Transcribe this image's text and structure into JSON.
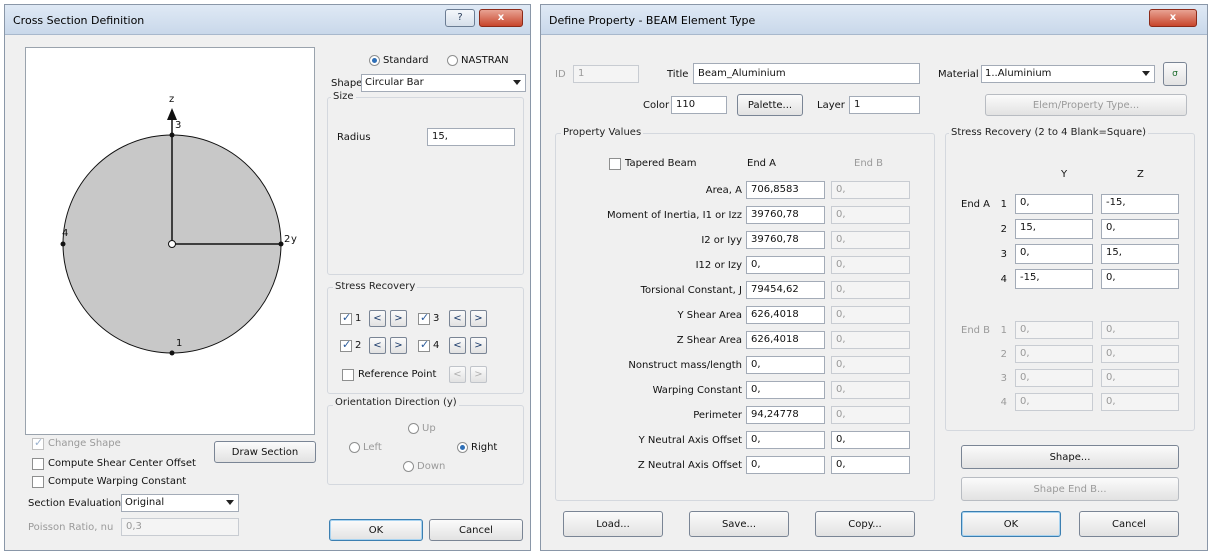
{
  "left_dialog": {
    "title": "Cross Section Definition",
    "help_btn": "?",
    "close_btn": "x",
    "shape_section": {
      "type_options": [
        "Standard",
        "NASTRAN"
      ],
      "selected_type": "Standard",
      "shape_label": "Shape",
      "shape_value": "Circular Bar",
      "size_label": "Size",
      "radius_label": "Radius",
      "radius_value": "15,"
    },
    "preview": {
      "z_label": "z",
      "y_label": "y",
      "point_labels": [
        "1",
        "2",
        "3",
        "4"
      ]
    },
    "stress_recovery": {
      "label": "Stress Recovery",
      "points": [
        {
          "label": "1",
          "checked": true
        },
        {
          "label": "3",
          "checked": true
        },
        {
          "label": "2",
          "checked": true
        },
        {
          "label": "4",
          "checked": true
        }
      ],
      "prev": "<",
      "next": ">",
      "reference_point_label": "Reference Point",
      "reference_point_checked": false
    },
    "orientation": {
      "label": "Orientation Direction (y)",
      "options": [
        "Up",
        "Left",
        "Right",
        "Down"
      ],
      "selected": "Right"
    },
    "change_shape_label": "Change Shape",
    "change_shape_checked": true,
    "draw_section_btn": "Draw Section",
    "shear_center_label": "Compute Shear Center Offset",
    "warping_constant_label": "Compute Warping Constant",
    "section_eval_label": "Section Evaluation",
    "section_eval_value": "Original",
    "poisson_label": "Poisson Ratio, nu",
    "poisson_value": "0,3",
    "ok_btn": "OK",
    "cancel_btn": "Cancel"
  },
  "right_dialog": {
    "title": "Define Property - BEAM Element Type",
    "close_btn": "x",
    "id_label": "ID",
    "id_value": "1",
    "title_label": "Title",
    "title_value": "Beam_Aluminium",
    "material_label": "Material",
    "material_value": "1..Aluminium",
    "color_label": "Color",
    "color_value": "110",
    "palette_btn": "Palette...",
    "layer_label": "Layer",
    "layer_value": "1",
    "elem_type_btn": "Elem/Property Type...",
    "property_values_label": "Property Values",
    "tapered_beam_label": "Tapered Beam",
    "tapered_beam_checked": false,
    "end_a_header": "End A",
    "end_b_header": "End B",
    "properties": [
      {
        "label": "Area, A",
        "end_a": "706,8583",
        "end_b": "0,",
        "end_b_enabled": false
      },
      {
        "label": "Moment of Inertia, I1 or Izz",
        "end_a": "39760,78",
        "end_b": "0,",
        "end_b_enabled": false
      },
      {
        "label": "I2 or Iyy",
        "end_a": "39760,78",
        "end_b": "0,",
        "end_b_enabled": false
      },
      {
        "label": "I12 or Izy",
        "end_a": "0,",
        "end_b": "0,",
        "end_b_enabled": false
      },
      {
        "label": "Torsional Constant, J",
        "end_a": "79454,62",
        "end_b": "0,",
        "end_b_enabled": false
      },
      {
        "label": "Y Shear Area",
        "end_a": "626,4018",
        "end_b": "0,",
        "end_b_enabled": false
      },
      {
        "label": "Z Shear Area",
        "end_a": "626,4018",
        "end_b": "0,",
        "end_b_enabled": false
      },
      {
        "label": "Nonstruct mass/length",
        "end_a": "0,",
        "end_b": "0,",
        "end_b_enabled": false
      },
      {
        "label": "Warping Constant",
        "end_a": "0,",
        "end_b": "0,",
        "end_b_enabled": false
      },
      {
        "label": "Perimeter",
        "end_a": "94,24778",
        "end_b": "0,",
        "end_b_enabled": false
      },
      {
        "label": "Y Neutral Axis Offset",
        "end_a": "0,",
        "end_b": "0,",
        "end_b_enabled": true
      },
      {
        "label": "Z Neutral Axis Offset",
        "end_a": "0,",
        "end_b": "0,",
        "end_b_enabled": true
      }
    ],
    "stress_recovery": {
      "label": "Stress Recovery (2 to 4 Blank=Square)",
      "y_header": "Y",
      "z_header": "Z",
      "end_a_label": "End A",
      "end_b_label": "End B",
      "end_a_rows": [
        {
          "n": "1",
          "y": "0,",
          "z": "-15,"
        },
        {
          "n": "2",
          "y": "15,",
          "z": "0,"
        },
        {
          "n": "3",
          "y": "0,",
          "z": "15,"
        },
        {
          "n": "4",
          "y": "-15,",
          "z": "0,"
        }
      ],
      "end_b_rows": [
        {
          "n": "1",
          "y": "0,",
          "z": "0,"
        },
        {
          "n": "2",
          "y": "0,",
          "z": "0,"
        },
        {
          "n": "3",
          "y": "0,",
          "z": "0,"
        },
        {
          "n": "4",
          "y": "0,",
          "z": "0,"
        }
      ]
    },
    "shape_btn": "Shape...",
    "shape_end_b_btn": "Shape End B...",
    "load_btn": "Load...",
    "save_btn": "Save...",
    "copy_btn": "Copy...",
    "ok_btn": "OK",
    "cancel_btn": "Cancel"
  },
  "colors": {
    "dialog_bg": "#f0f0f0",
    "title_bar": "#d4e0ef",
    "circle_fill": "#c8c8c8",
    "accent_blue": "#2f6fb7",
    "close_red": "#c8452c"
  }
}
